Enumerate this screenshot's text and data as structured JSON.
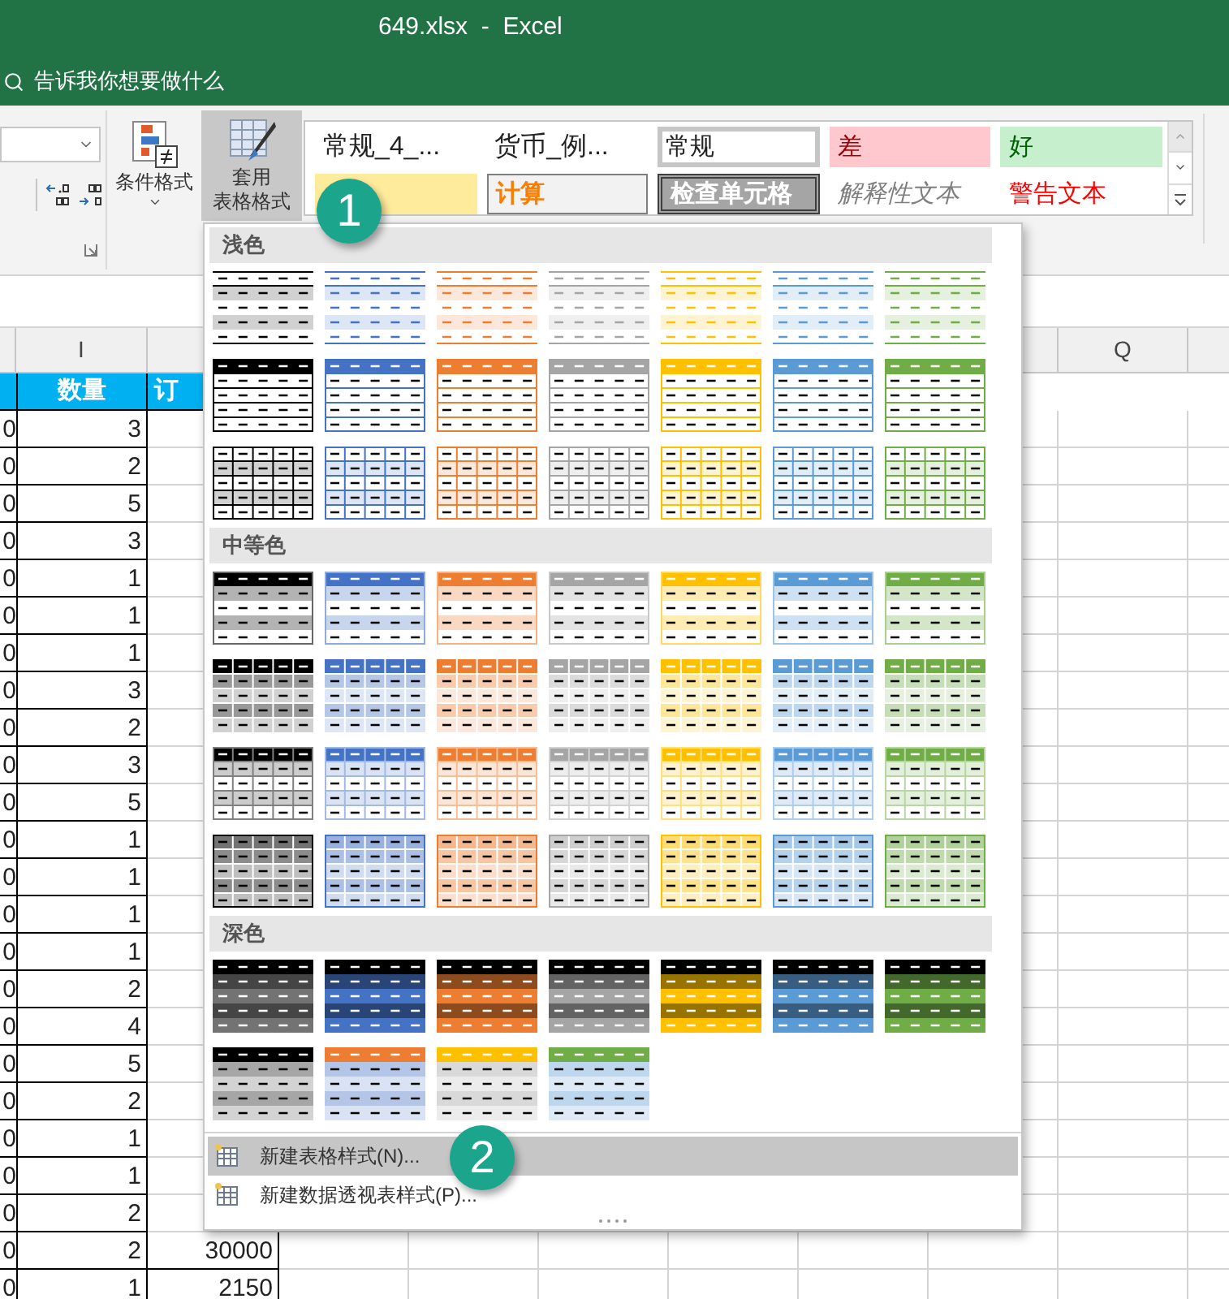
{
  "window": {
    "title": "649.xlsx  -  Excel"
  },
  "tell_me": {
    "placeholder": "告诉我你想要做什么"
  },
  "ribbon": {
    "buttons": [
      {
        "label": "条件格式",
        "selected": false
      },
      {
        "label_lines": [
          "套用",
          "表格格式"
        ],
        "selected": true
      }
    ],
    "cell_styles": [
      {
        "kind": "plain",
        "label": "常规_4_...",
        "selected": false
      },
      {
        "kind": "plain",
        "label": "货币_例...",
        "selected": false
      },
      {
        "kind": "normal",
        "label": "常规",
        "selected": true
      },
      {
        "kind": "bad",
        "label": "差",
        "selected": false
      },
      {
        "kind": "good",
        "label": "好",
        "selected": false
      },
      {
        "kind": "neutral",
        "selected": false
      },
      {
        "kind": "calculation",
        "label": "计算",
        "selected": false
      },
      {
        "kind": "check",
        "label": "检查单元格",
        "selected": false
      },
      {
        "kind": "explanatory",
        "label": "解释性文本",
        "selected": false
      },
      {
        "kind": "warning",
        "label": "警告文本",
        "selected": false
      }
    ]
  },
  "sheet": {
    "column_headers": [
      "I",
      "Q"
    ],
    "header_row": {
      "quantity": "数量",
      "column_3": "订"
    },
    "rows": [
      {
        "column_1": "0",
        "quantity": "3"
      },
      {
        "column_1": "0",
        "quantity": "2"
      },
      {
        "column_1": "0",
        "quantity": "5"
      },
      {
        "column_1": "0",
        "quantity": "3"
      },
      {
        "column_1": "0",
        "quantity": "1"
      },
      {
        "column_1": "0",
        "quantity": "1"
      },
      {
        "column_1": "0",
        "quantity": "1"
      },
      {
        "column_1": "0",
        "quantity": "3"
      },
      {
        "column_1": "0",
        "quantity": "2"
      },
      {
        "column_1": "0",
        "quantity": "3"
      },
      {
        "column_1": "0",
        "quantity": "5"
      },
      {
        "column_1": "0",
        "quantity": "1"
      },
      {
        "column_1": "0",
        "quantity": "1"
      },
      {
        "column_1": "0",
        "quantity": "1"
      },
      {
        "column_1": "0",
        "quantity": "1"
      },
      {
        "column_1": "0",
        "quantity": "2"
      },
      {
        "column_1": "0",
        "quantity": "4"
      },
      {
        "column_1": "0",
        "quantity": "5"
      },
      {
        "column_1": "0",
        "quantity": "2"
      },
      {
        "column_1": "0",
        "quantity": "1"
      },
      {
        "column_1": "0",
        "quantity": "1"
      },
      {
        "column_1": "0",
        "quantity": "2"
      },
      {
        "column_1": "0",
        "quantity": "2",
        "column_3": "30000"
      },
      {
        "column_1": "0",
        "quantity": "1",
        "column_3": "2150"
      }
    ]
  },
  "table_styles_menu": {
    "sections": [
      {
        "title": "浅色",
        "rows": [
          {
            "items": [
              {
                "kind": "light-banded",
                "color": "#000000"
              },
              {
                "kind": "light-banded",
                "color": "#4472c4"
              },
              {
                "kind": "light-banded",
                "color": "#ed7d31"
              },
              {
                "kind": "light-banded",
                "color": "#a5a5a5"
              },
              {
                "kind": "light-banded",
                "color": "#ffc000"
              },
              {
                "kind": "light-banded",
                "color": "#5b9bd5"
              },
              {
                "kind": "light-banded",
                "color": "#70ad47"
              }
            ]
          },
          {
            "items": [
              {
                "kind": "light-header",
                "color": "#000000"
              },
              {
                "kind": "light-header",
                "color": "#4472c4"
              },
              {
                "kind": "light-header",
                "color": "#ed7d31"
              },
              {
                "kind": "light-header",
                "color": "#a5a5a5"
              },
              {
                "kind": "light-header",
                "color": "#ffc000"
              },
              {
                "kind": "light-header",
                "color": "#5b9bd5"
              },
              {
                "kind": "light-header",
                "color": "#70ad47"
              }
            ]
          },
          {
            "items": [
              {
                "kind": "light-grid",
                "color": "#000000"
              },
              {
                "kind": "light-grid",
                "color": "#4472c4"
              },
              {
                "kind": "light-grid",
                "color": "#ed7d31"
              },
              {
                "kind": "light-grid",
                "color": "#a5a5a5"
              },
              {
                "kind": "light-grid",
                "color": "#ffc000"
              },
              {
                "kind": "light-grid",
                "color": "#5b9bd5"
              },
              {
                "kind": "light-grid",
                "color": "#70ad47"
              }
            ]
          }
        ]
      },
      {
        "title": "中等色",
        "rows": [
          {
            "items": [
              {
                "kind": "medium-banded",
                "color": "#000000"
              },
              {
                "kind": "medium-banded",
                "color": "#4472c4"
              },
              {
                "kind": "medium-banded",
                "color": "#ed7d31"
              },
              {
                "kind": "medium-banded",
                "color": "#a5a5a5"
              },
              {
                "kind": "medium-banded",
                "color": "#ffc000"
              },
              {
                "kind": "medium-banded",
                "color": "#5b9bd5"
              },
              {
                "kind": "medium-banded",
                "color": "#70ad47"
              }
            ]
          },
          {
            "items": [
              {
                "kind": "medium-grid-banded",
                "color": "#000000"
              },
              {
                "kind": "medium-grid-banded",
                "color": "#4472c4"
              },
              {
                "kind": "medium-grid-banded",
                "color": "#ed7d31"
              },
              {
                "kind": "medium-grid-banded",
                "color": "#a5a5a5"
              },
              {
                "kind": "medium-grid-banded",
                "color": "#ffc000"
              },
              {
                "kind": "medium-grid-banded",
                "color": "#5b9bd5"
              },
              {
                "kind": "medium-grid-banded",
                "color": "#70ad47"
              }
            ]
          },
          {
            "items": [
              {
                "kind": "medium-header-rule",
                "color": "#000000"
              },
              {
                "kind": "medium-header-rule",
                "color": "#4472c4"
              },
              {
                "kind": "medium-header-rule",
                "color": "#ed7d31"
              },
              {
                "kind": "medium-header-rule",
                "color": "#a5a5a5"
              },
              {
                "kind": "medium-header-rule",
                "color": "#ffc000"
              },
              {
                "kind": "medium-header-rule",
                "color": "#5b9bd5"
              },
              {
                "kind": "medium-header-rule",
                "color": "#70ad47"
              }
            ]
          },
          {
            "items": [
              {
                "kind": "medium-filled",
                "color": "#000000"
              },
              {
                "kind": "medium-filled",
                "color": "#4472c4"
              },
              {
                "kind": "medium-filled",
                "color": "#ed7d31"
              },
              {
                "kind": "medium-filled",
                "color": "#a5a5a5"
              },
              {
                "kind": "medium-filled",
                "color": "#ffc000"
              },
              {
                "kind": "medium-filled",
                "color": "#5b9bd5"
              },
              {
                "kind": "medium-filled",
                "color": "#70ad47"
              }
            ]
          }
        ]
      },
      {
        "title": "深色",
        "rows": [
          {
            "items": [
              {
                "kind": "dark-banded",
                "color": "#737373"
              },
              {
                "kind": "dark-banded",
                "color": "#4472c4"
              },
              {
                "kind": "dark-banded",
                "color": "#ed7d31"
              },
              {
                "kind": "dark-banded",
                "color": "#a5a5a5"
              },
              {
                "kind": "dark-banded",
                "color": "#ffc000"
              },
              {
                "kind": "dark-banded",
                "color": "#5b9bd5"
              },
              {
                "kind": "dark-banded",
                "color": "#70ad47"
              }
            ]
          },
          {
            "items": [
              {
                "kind": "dark-header",
                "color": "#000000",
                "bands": {
                  "color": "#a6a6a6"
                }
              },
              {
                "kind": "dark-header",
                "color": "#ed7d31",
                "bands": {
                  "color": "#b4c6e7"
                }
              },
              {
                "kind": "dark-header",
                "color": "#ffc000",
                "bands": {
                  "color": "#d9d9d9"
                }
              },
              {
                "kind": "dark-header",
                "color": "#70ad47",
                "bands": {
                  "color": "#bdd7ee"
                }
              }
            ]
          }
        ]
      }
    ],
    "menu_items": [
      {
        "label": "新建表格样式(N)...",
        "selected": true
      },
      {
        "label": "新建数据透视表样式(P)...",
        "selected": false
      }
    ]
  },
  "annotations": [
    {
      "label": "1"
    },
    {
      "label": "2"
    }
  ]
}
